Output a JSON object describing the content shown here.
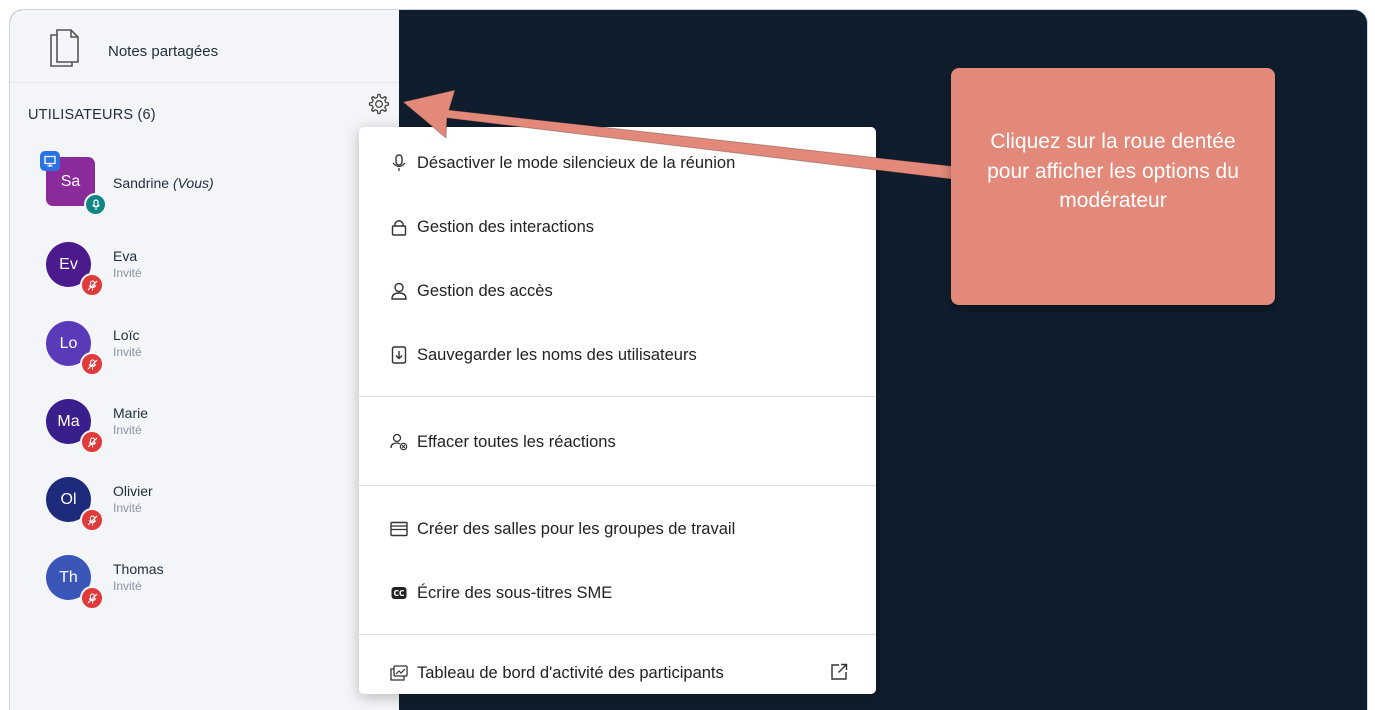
{
  "sidebar": {
    "notes_label": "Notes partagées",
    "users_header": "UTILISATEURS (6)",
    "users": [
      {
        "initials": "Sa",
        "name": "Sandrine",
        "you": "(Vous)",
        "role": "",
        "color": "#8a2a9b",
        "presenter": true,
        "muted": false
      },
      {
        "initials": "Ev",
        "name": "Eva",
        "role": "Invité",
        "color": "#4b1a8c",
        "muted": true
      },
      {
        "initials": "Lo",
        "name": "Loïc",
        "role": "Invité",
        "color": "#5a3ab8",
        "muted": true
      },
      {
        "initials": "Ma",
        "name": "Marie",
        "role": "Invité",
        "color": "#3a1e8c",
        "muted": true
      },
      {
        "initials": "Ol",
        "name": "Olivier",
        "role": "Invité",
        "color": "#1e2a7a",
        "muted": true
      },
      {
        "initials": "Th",
        "name": "Thomas",
        "role": "Invité",
        "color": "#3a56b8",
        "muted": true
      }
    ]
  },
  "menu": {
    "items": [
      {
        "label": "Désactiver le mode silencieux de la réunion",
        "icon": "microphone-icon"
      },
      {
        "label": "Gestion des interactions",
        "icon": "lock-icon"
      },
      {
        "label": "Gestion des accès",
        "icon": "user-icon"
      },
      {
        "label": "Sauvegarder les noms des utilisateurs",
        "icon": "download-file-icon"
      },
      {
        "label": "Effacer toutes les réactions",
        "icon": "clear-reactions-icon"
      },
      {
        "label": "Créer des salles pour les groupes de travail",
        "icon": "rooms-icon"
      },
      {
        "label": "Écrire des sous-titres SME",
        "icon": "closed-captions-icon"
      },
      {
        "label": "Tableau de bord d'activité des participants",
        "icon": "dashboard-icon"
      }
    ]
  },
  "callout": {
    "text": "Cliquez sur la roue dentée pour afficher les options du modérateur"
  },
  "colors": {
    "accent": "#e2897a",
    "dark_bg": "#0f1d2d",
    "mute": "#e03a3a"
  }
}
